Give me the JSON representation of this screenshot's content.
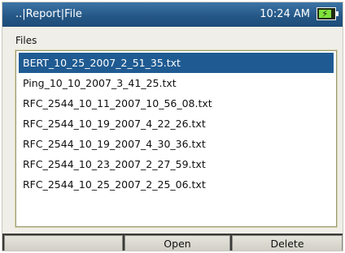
{
  "titlebar": {
    "title": "..|Report|File",
    "time": "10:24 AM",
    "battery_icon": "battery-charging-icon"
  },
  "files_label": "Files",
  "files": [
    {
      "name": "BERT_10_25_2007_2_51_35.txt",
      "selected": true
    },
    {
      "name": "Ping_10_10_2007_3_41_25.txt",
      "selected": false
    },
    {
      "name": "RFC_2544_10_11_2007_10_56_08.txt",
      "selected": false
    },
    {
      "name": "RFC_2544_10_19_2007_4_22_26.txt",
      "selected": false
    },
    {
      "name": "RFC_2544_10_19_2007_4_30_36.txt",
      "selected": false
    },
    {
      "name": "RFC_2544_10_23_2007_2_27_59.txt",
      "selected": false
    },
    {
      "name": "RFC_2544_10_25_2007_2_25_06.txt",
      "selected": false
    }
  ],
  "buttons": {
    "open": "Open",
    "delete": "Delete"
  },
  "colors": {
    "titlebar": "#245685",
    "selection": "#1f5b92",
    "battery_fill": "#7fe23a"
  }
}
